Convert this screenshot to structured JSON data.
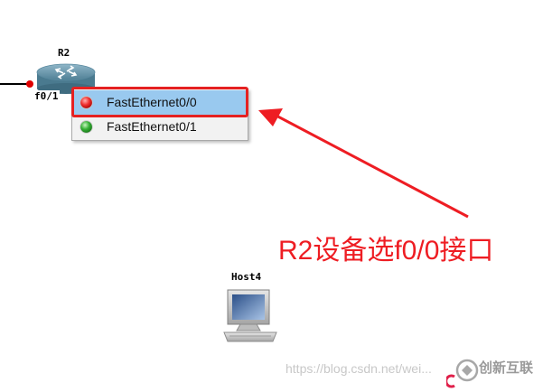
{
  "topology": {
    "router": {
      "name": "R2",
      "port_label": "f0/1"
    },
    "host": {
      "name": "Host4"
    }
  },
  "context_menu": {
    "items": [
      {
        "label": "FastEthernet0/0",
        "status": "down",
        "status_color": "#e02020",
        "selected": true
      },
      {
        "label": "FastEthernet0/1",
        "status": "up",
        "status_color": "#25a025",
        "selected": false
      }
    ],
    "selected_bg": "#99c9ef"
  },
  "annotation": {
    "text": "R2设备选f0/0接口",
    "color": "#ee1d23"
  },
  "watermark": {
    "url_text": "https://blog.csdn.net/wei...",
    "brand": "创新互联"
  },
  "icons": {
    "router": "router-icon",
    "host": "desktop-computer-icon",
    "led_down": "red-led-icon",
    "led_up": "green-led-icon",
    "arrow": "red-arrow-icon"
  }
}
